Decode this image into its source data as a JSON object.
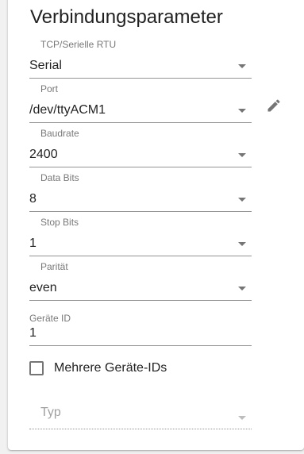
{
  "section": {
    "title": "Verbindungsparameter"
  },
  "fields": {
    "connection_type": {
      "label": "TCP/Serielle RTU",
      "value": "Serial"
    },
    "port": {
      "label": "Port",
      "value": "/dev/ttyACM1"
    },
    "baudrate": {
      "label": "Baudrate",
      "value": "2400"
    },
    "data_bits": {
      "label": "Data Bits",
      "value": "8"
    },
    "stop_bits": {
      "label": "Stop Bits",
      "value": "1"
    },
    "parity": {
      "label": "Parität",
      "value": "even"
    },
    "device_id": {
      "label": "Geräte ID",
      "value": "1"
    },
    "type": {
      "placeholder": "Typ",
      "value": ""
    }
  },
  "multiple_ids": {
    "label": "Mehrere Geräte-IDs",
    "checked": false
  },
  "icons": {
    "edit": "pencil-icon",
    "dropdown": "triangle-down-icon"
  }
}
